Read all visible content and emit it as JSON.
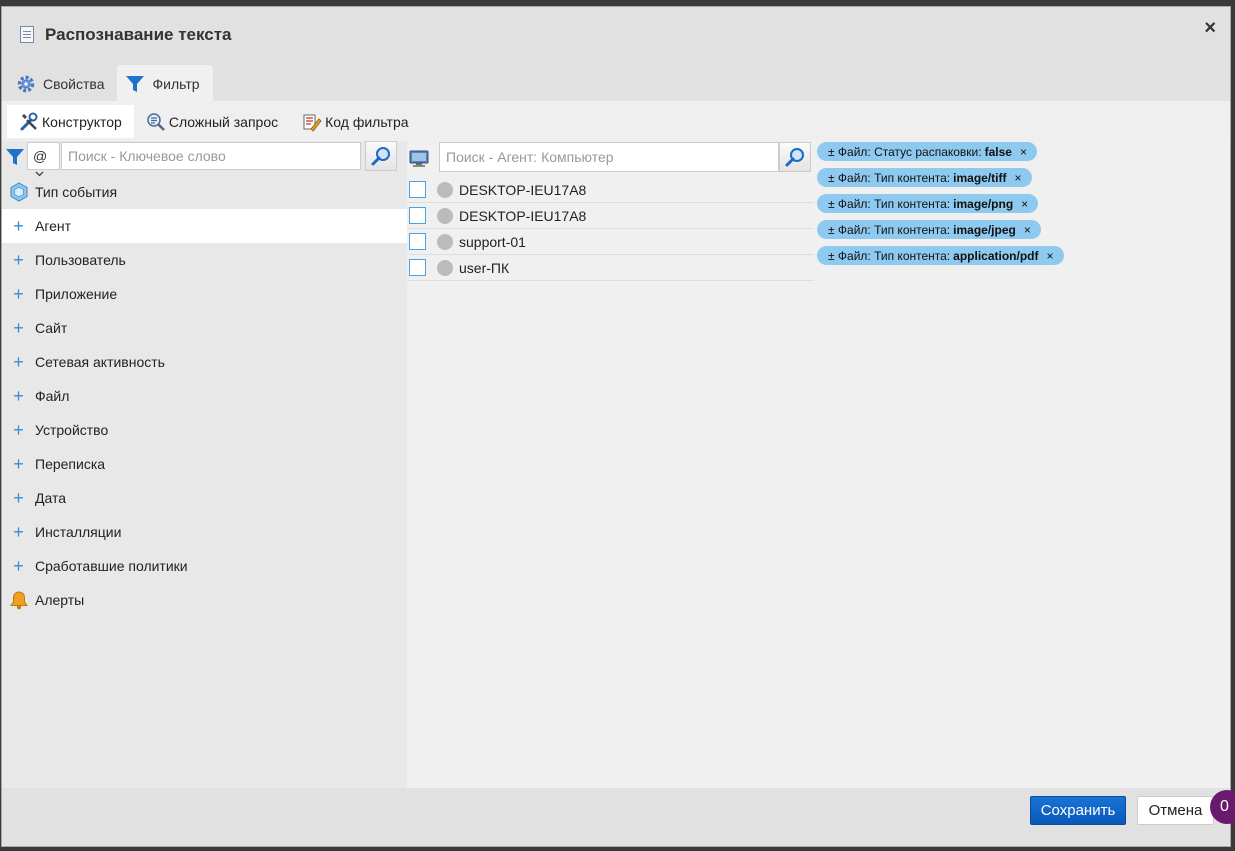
{
  "dialog": {
    "title": "Распознавание текста",
    "close_symbol": "×"
  },
  "tabs": [
    {
      "label": "Свойства",
      "icon": "gear-icon"
    },
    {
      "label": "Фильтр",
      "icon": "funnel-icon"
    }
  ],
  "subtabs": [
    {
      "label": "Конструктор",
      "icon": "tools-icon"
    },
    {
      "label": "Сложный запрос",
      "icon": "query-icon"
    },
    {
      "label": "Код фильтра",
      "icon": "code-icon"
    }
  ],
  "left": {
    "operator": "@",
    "search_placeholder": "Поиск - Ключевое слово",
    "tree": [
      {
        "label": "Тип события",
        "marker": "cube-icon"
      },
      {
        "label": "Агент",
        "marker": "plus"
      },
      {
        "label": "Пользователь",
        "marker": "plus"
      },
      {
        "label": "Приложение",
        "marker": "plus"
      },
      {
        "label": "Сайт",
        "marker": "plus"
      },
      {
        "label": "Сетевая активность",
        "marker": "plus"
      },
      {
        "label": "Файл",
        "marker": "plus"
      },
      {
        "label": "Устройство",
        "marker": "plus"
      },
      {
        "label": "Переписка",
        "marker": "plus"
      },
      {
        "label": "Дата",
        "marker": "plus"
      },
      {
        "label": "Инсталляции",
        "marker": "plus"
      },
      {
        "label": "Сработавшие политики",
        "marker": "plus"
      },
      {
        "label": "Алерты",
        "marker": "bell-icon"
      }
    ]
  },
  "middle": {
    "search_placeholder": "Поиск - Агент: Компьютер",
    "agents": [
      "DESKTOP-IEU17A8",
      "DESKTOP-IEU17A8",
      "support-01",
      "user-ПК"
    ]
  },
  "chips": [
    {
      "prefix": "± Файл: Статус распаковки:",
      "value": "false"
    },
    {
      "prefix": "± Файл: Тип контента:",
      "value": "image/tiff"
    },
    {
      "prefix": "± Файл: Тип контента:",
      "value": "image/png"
    },
    {
      "prefix": "± Файл: Тип контента:",
      "value": "image/jpeg"
    },
    {
      "prefix": "± Файл: Тип контента:",
      "value": "application/pdf"
    }
  ],
  "chip_remove_symbol": "×",
  "footer": {
    "save_label": "Сохранить",
    "cancel_label": "Отмена",
    "badge_count": "0"
  },
  "colors": {
    "accent": "#3b8ad6",
    "chip": "#8ec9f0",
    "save_button": "#0a59b8",
    "badge": "#6a1a6e"
  }
}
